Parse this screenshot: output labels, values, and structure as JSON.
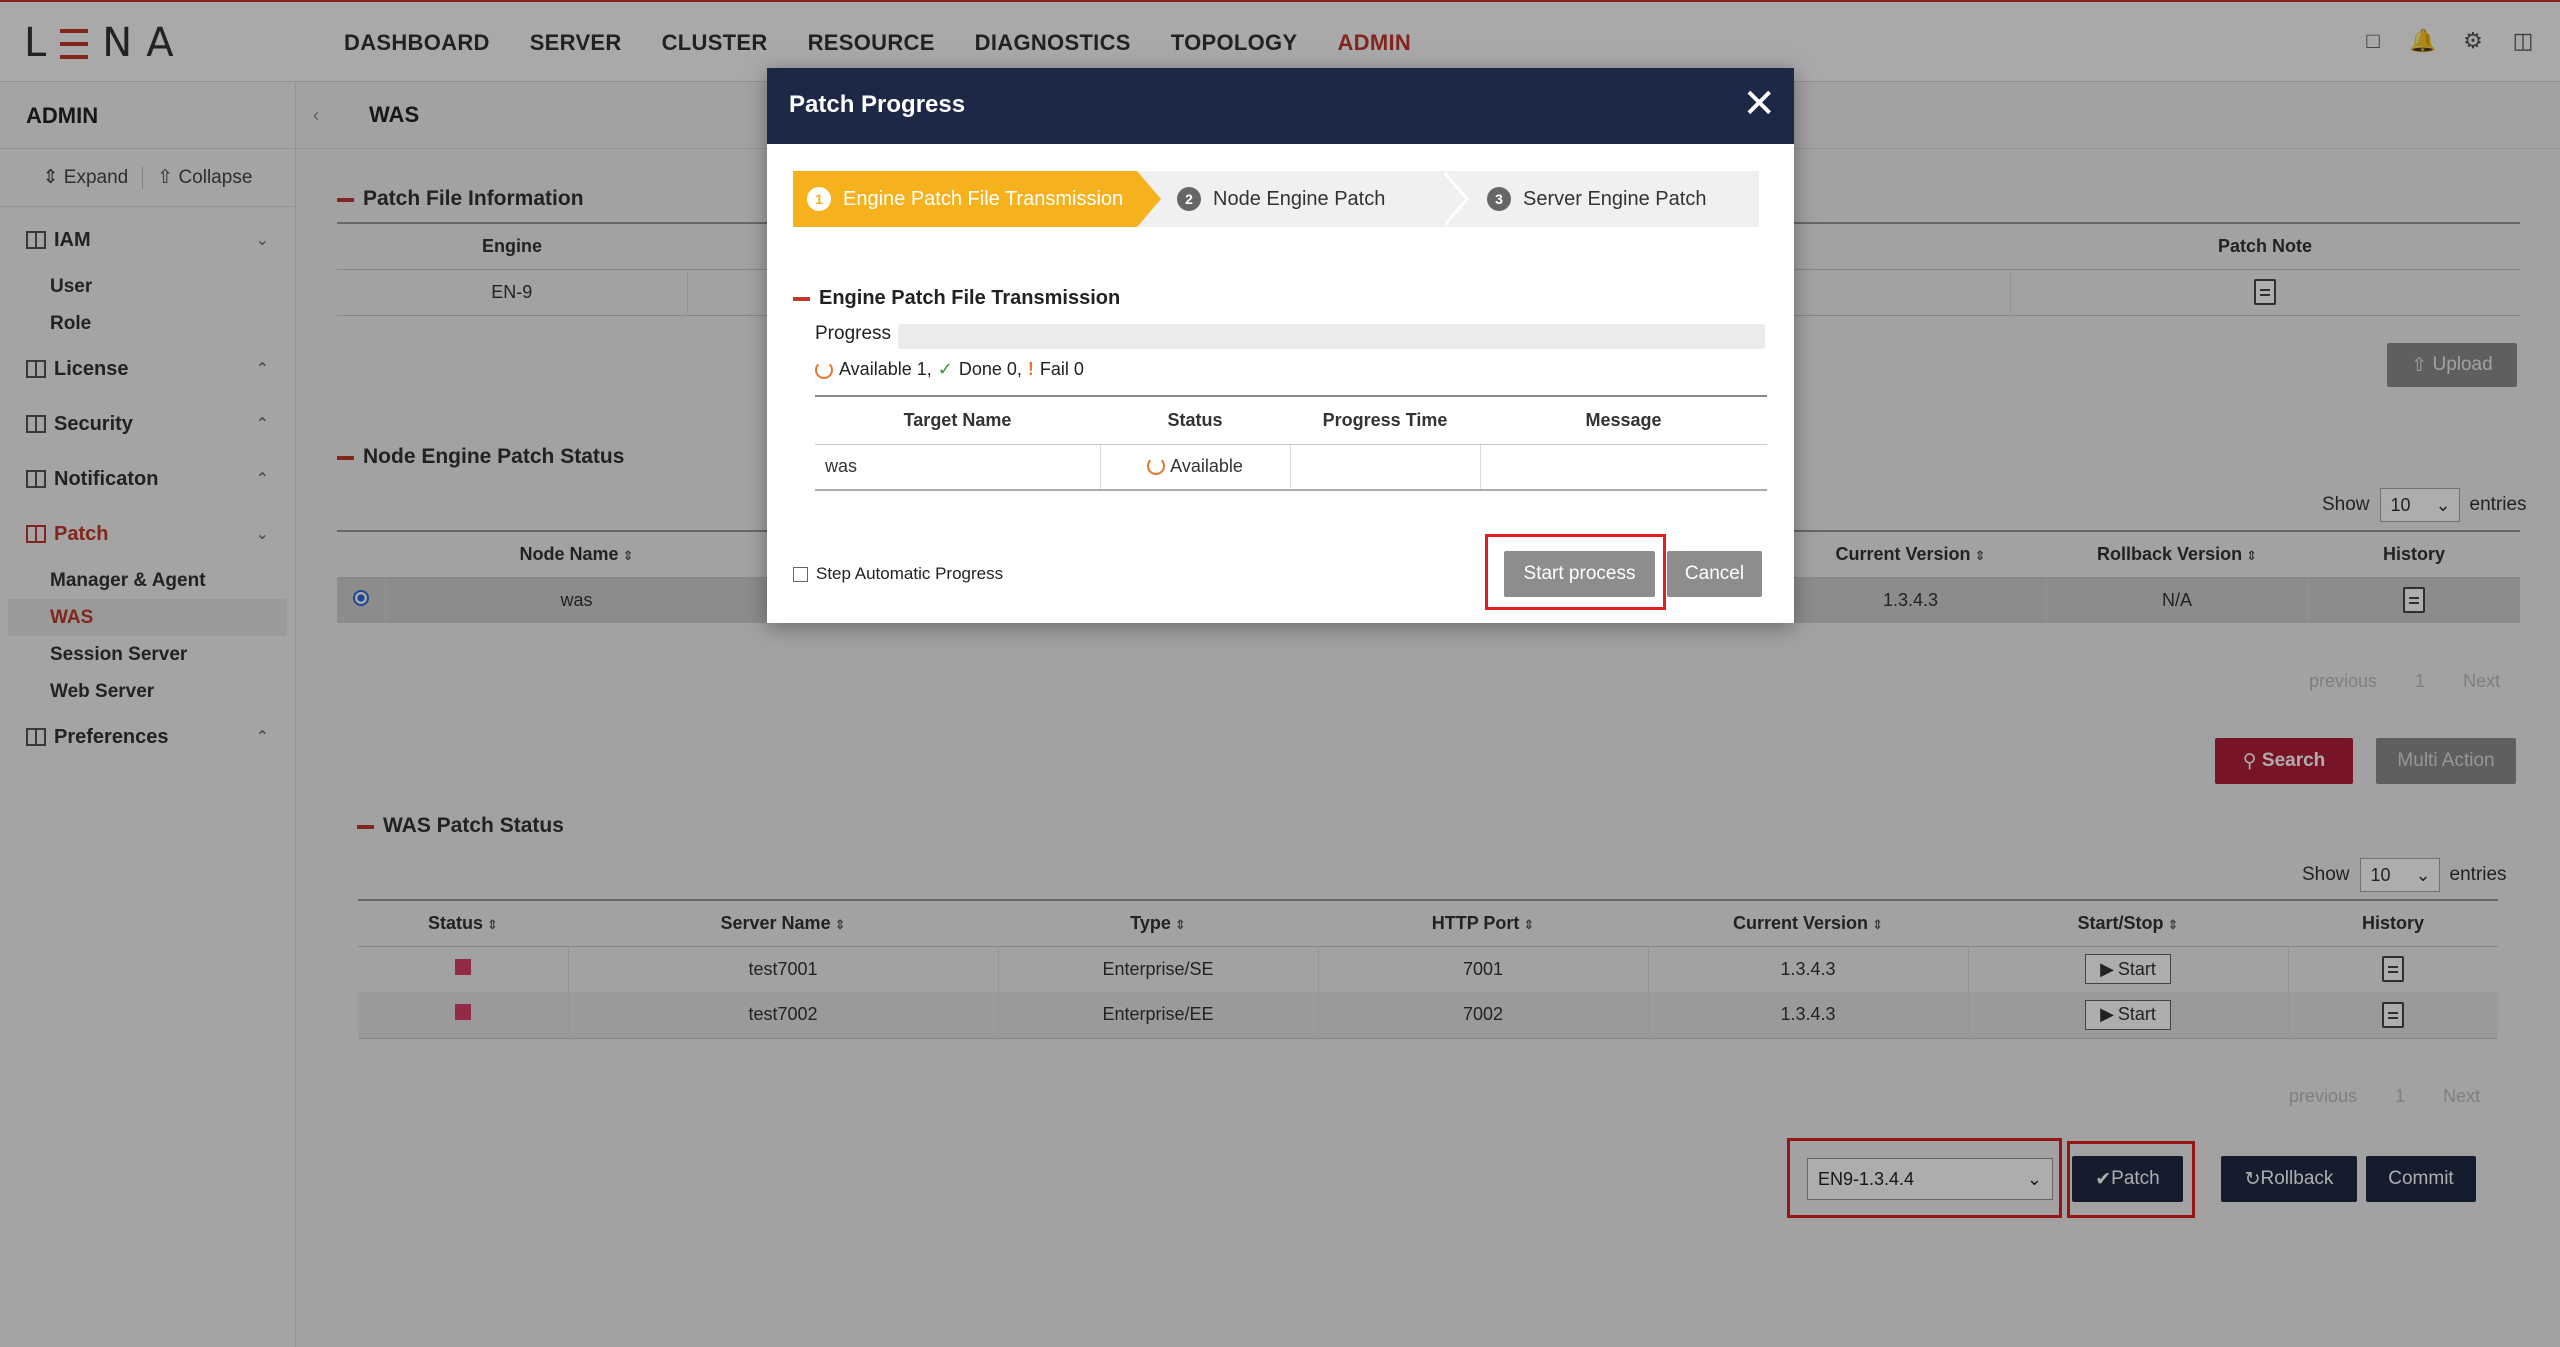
{
  "header": {
    "logo": "LENA",
    "nav": [
      "DASHBOARD",
      "SERVER",
      "CLUSTER",
      "RESOURCE",
      "DIAGNOSTICS",
      "TOPOLOGY",
      "ADMIN"
    ]
  },
  "sidebar": {
    "title": "ADMIN",
    "expand": "Expand",
    "collapse": "Collapse",
    "groups": {
      "iam": "IAM",
      "license": "License",
      "security": "Security",
      "notification": "Notificaton",
      "patch": "Patch",
      "preferences": "Preferences"
    },
    "iam_items": [
      "User",
      "Role"
    ],
    "patch_items": [
      "Manager & Agent",
      "WAS",
      "Session Server",
      "Web Server"
    ]
  },
  "page": {
    "title": "WAS",
    "patch_file_info": {
      "title": "Patch File Information",
      "col_engine": "Engine",
      "col_patch_note": "Patch Note",
      "engine_value": "EN-9",
      "upload": "Upload"
    },
    "node_status": {
      "title": "Node Engine Patch Status",
      "show": "Show",
      "entries": "entries",
      "page_size": "10",
      "cols": [
        "Node Name",
        "Current Version",
        "Rollback Version",
        "History"
      ],
      "row": {
        "node": "was",
        "current": "1.3.4.3",
        "rollback": "N/A"
      },
      "prev": "previous",
      "page": "1",
      "next": "Next",
      "search": "Search",
      "multi_action": "Multi Action"
    },
    "was_status": {
      "title": "WAS Patch Status",
      "show": "Show",
      "entries": "entries",
      "page_size": "10",
      "cols": [
        "Status",
        "Server Name",
        "Type",
        "HTTP Port",
        "Current Version",
        "Start/Stop",
        "History"
      ],
      "rows": [
        {
          "name": "test7001",
          "type": "Enterprise/SE",
          "port": "7001",
          "version": "1.3.4.3",
          "action": "Start"
        },
        {
          "name": "test7002",
          "type": "Enterprise/EE",
          "port": "7002",
          "version": "1.3.4.3",
          "action": "Start"
        }
      ],
      "prev": "previous",
      "page": "1",
      "next": "Next"
    },
    "patch_version": "EN9-1.3.4.4",
    "patch_btn": "Patch",
    "rollback_btn": "Rollback",
    "commit_btn": "Commit"
  },
  "modal": {
    "title": "Patch Progress",
    "steps": [
      {
        "num": "1",
        "label": "Engine Patch File Transmission"
      },
      {
        "num": "2",
        "label": "Node Engine Patch"
      },
      {
        "num": "3",
        "label": "Server Engine Patch"
      }
    ],
    "section": "Engine Patch File Transmission",
    "progress_label": "Progress",
    "progress": 0,
    "available": "Available 1,",
    "done": "Done 0,",
    "fail": "Fail 0",
    "cols": [
      "Target Name",
      "Status",
      "Progress Time",
      "Message"
    ],
    "row": {
      "target": "was",
      "status": "Available",
      "time": "",
      "message": ""
    },
    "step_auto": "Step Automatic Progress",
    "start": "Start process",
    "cancel": "Cancel"
  },
  "colors": {
    "accent": "#c0392b",
    "navy": "#1d2846",
    "step_active": "#f5b21c"
  }
}
